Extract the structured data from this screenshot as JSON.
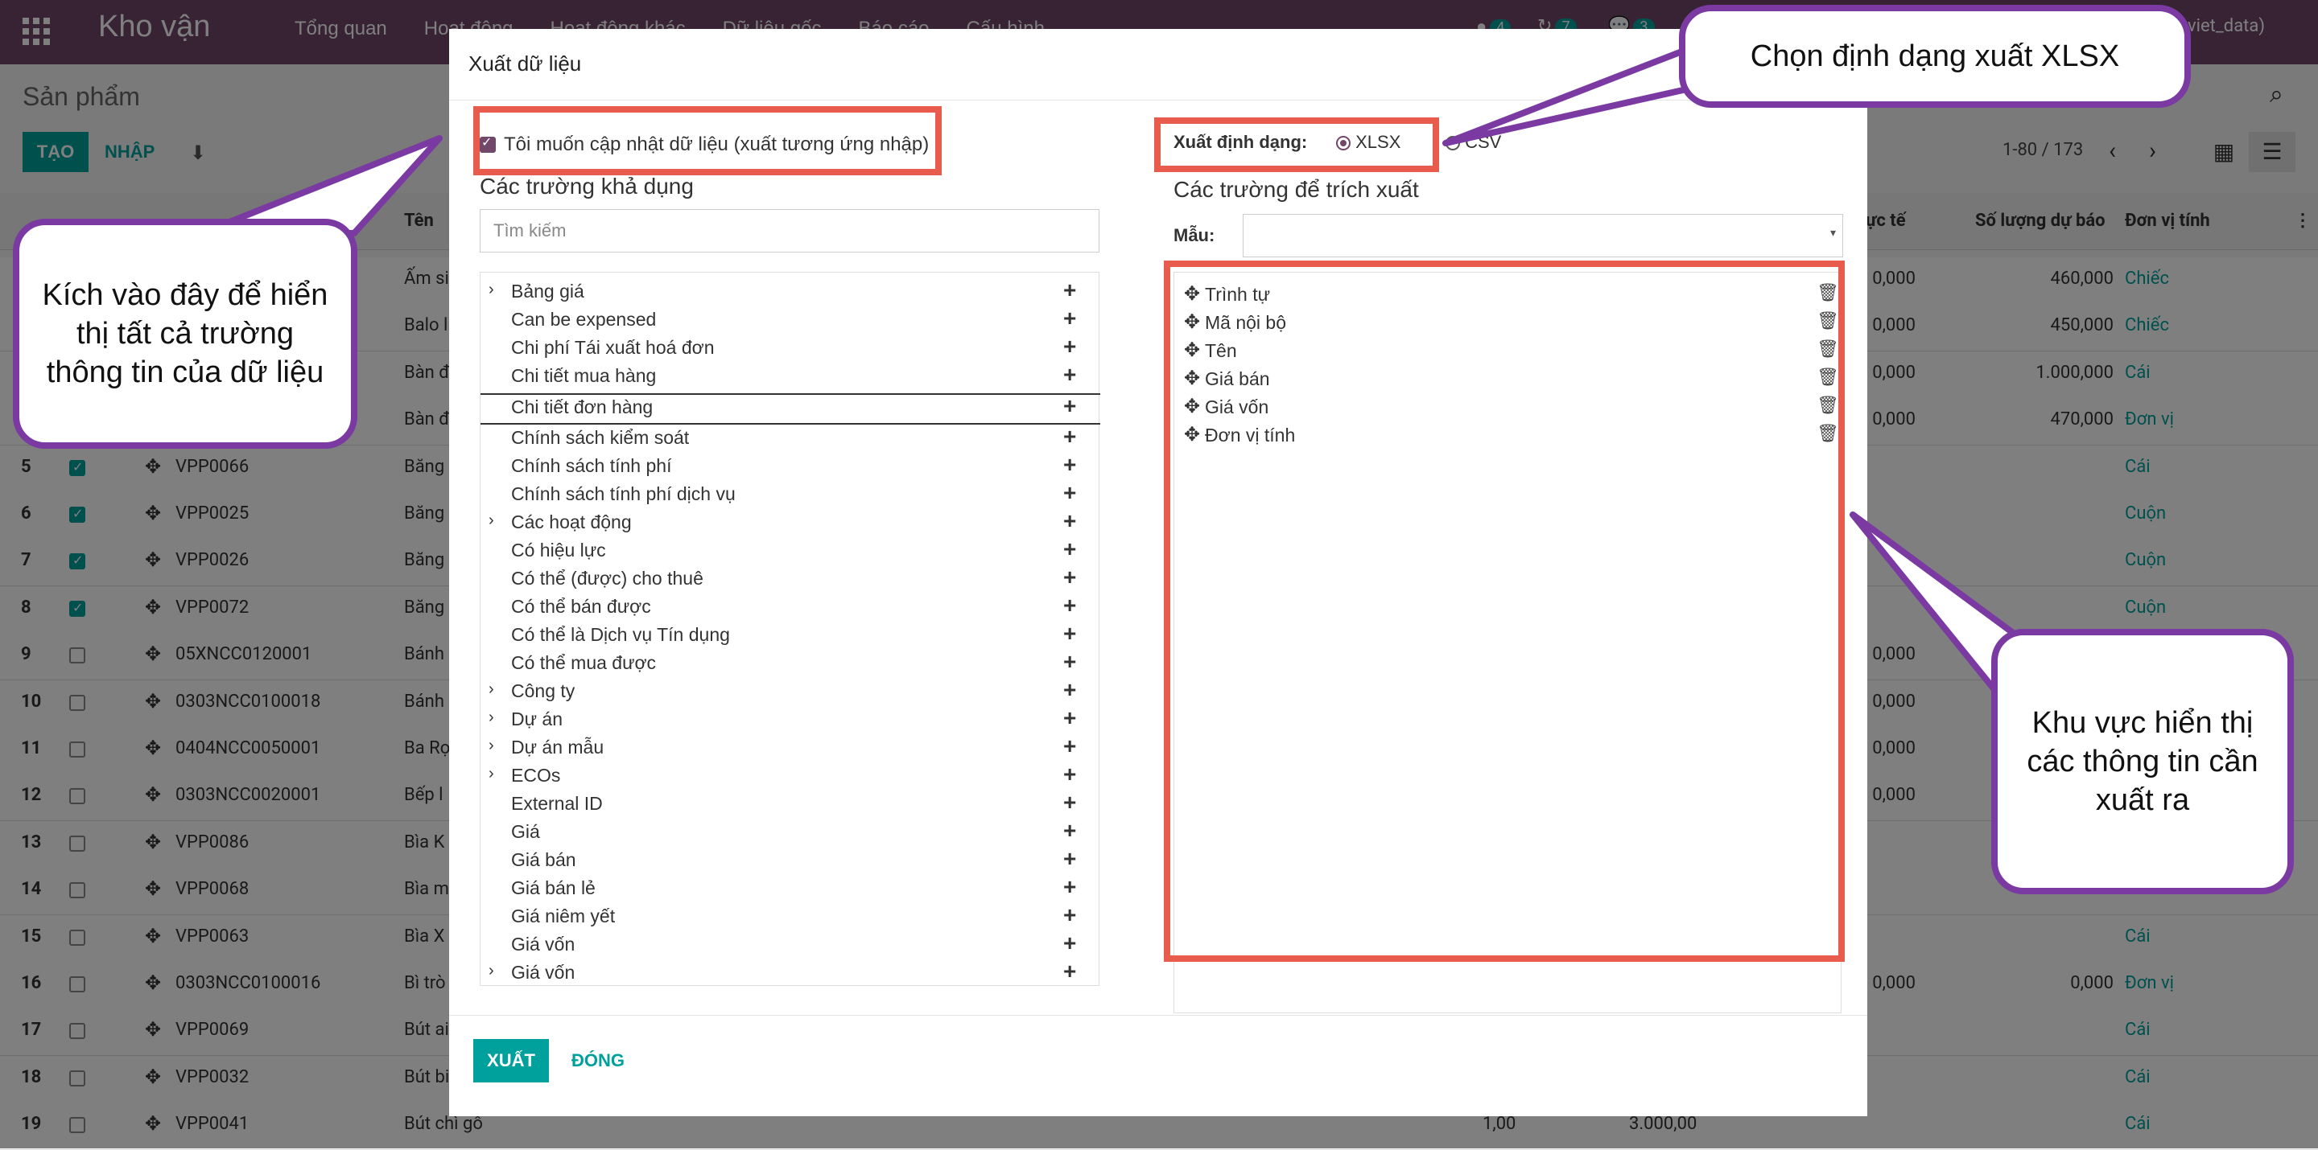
{
  "app": {
    "title": "Kho vận",
    "menu": [
      "Tổng quan",
      "Hoạt động",
      "Hoạt động khác",
      "Dữ liệu gốc",
      "Báo cáo",
      "Cấu hình"
    ],
    "badges": [
      "4",
      "7",
      "3"
    ],
    "user_suffix": "viet_data)"
  },
  "control": {
    "breadcrumb": "Sản phẩm",
    "create_label": "TẠO",
    "import_label": "NHẬP",
    "pager": "1-80 / 173"
  },
  "list": {
    "headers": {
      "name": "Tên",
      "cost": "ực tế",
      "forecast": "Số lượng dự báo",
      "unit": "Đơn vị tính"
    },
    "rows": [
      {
        "n": "",
        "code": "",
        "name": "Ấm si",
        "c1": "",
        "c2": "",
        "c3": "0,000",
        "c4": "460,000",
        "unit": "Chiếc",
        "checked": false
      },
      {
        "n": "",
        "code": "",
        "name": "Balo l",
        "c1": "",
        "c2": "",
        "c3": "0,000",
        "c4": "450,000",
        "unit": "Chiếc",
        "checked": false
      },
      {
        "n": "",
        "code": "",
        "name": "Bàn đ",
        "c1": "",
        "c2": "",
        "c3": "0,000",
        "c4": "1.000,000",
        "unit": "Cái",
        "checked": false
      },
      {
        "n": "",
        "code": "",
        "name": "Bàn đ",
        "c1": "",
        "c2": "",
        "c3": "0,000",
        "c4": "470,000",
        "unit": "Đơn vị",
        "checked": false
      },
      {
        "n": "5",
        "code": "VPP0066",
        "name": "Băng",
        "c1": "",
        "c2": "",
        "c3": "",
        "c4": "",
        "unit": "Cái",
        "checked": true
      },
      {
        "n": "6",
        "code": "VPP0025",
        "name": "Băng",
        "c1": "",
        "c2": "",
        "c3": "",
        "c4": "",
        "unit": "Cuộn",
        "checked": true
      },
      {
        "n": "7",
        "code": "VPP0026",
        "name": "Băng",
        "c1": "",
        "c2": "",
        "c3": "",
        "c4": "",
        "unit": "Cuộn",
        "checked": true
      },
      {
        "n": "8",
        "code": "VPP0072",
        "name": "Băng",
        "c1": "",
        "c2": "",
        "c3": "",
        "c4": "",
        "unit": "Cuộn",
        "checked": true
      },
      {
        "n": "9",
        "code": "05XNCC0120001",
        "name": "Bánh",
        "c1": "",
        "c2": "",
        "c3": "0,000",
        "c4": "",
        "unit": "",
        "checked": false
      },
      {
        "n": "10",
        "code": "0303NCC0100018",
        "name": "Bánh",
        "c1": "",
        "c2": "",
        "c3": "0,000",
        "c4": "",
        "unit": "",
        "checked": false
      },
      {
        "n": "11",
        "code": "0404NCC0050001",
        "name": "Ba Rọ",
        "c1": "",
        "c2": "",
        "c3": "0,000",
        "c4": "",
        "unit": "",
        "checked": false
      },
      {
        "n": "12",
        "code": "0303NCC0020001",
        "name": "Bếp l",
        "c1": "",
        "c2": "",
        "c3": "0,000",
        "c4": "",
        "unit": "",
        "checked": false
      },
      {
        "n": "13",
        "code": "VPP0086",
        "name": "Bìa K",
        "c1": "",
        "c2": "",
        "c3": "",
        "c4": "",
        "unit": "",
        "checked": false
      },
      {
        "n": "14",
        "code": "VPP0068",
        "name": "Bìa m",
        "c1": "",
        "c2": "",
        "c3": "",
        "c4": "",
        "unit": "",
        "checked": false
      },
      {
        "n": "15",
        "code": "VPP0063",
        "name": "Bìa X",
        "c1": "",
        "c2": "",
        "c3": "",
        "c4": "",
        "unit": "Cái",
        "checked": false
      },
      {
        "n": "16",
        "code": "0303NCC0100016",
        "name": "Bì trò",
        "c1": "",
        "c2": "",
        "c3": "0,000",
        "c4": "0,000",
        "unit": "Đơn vị",
        "checked": false
      },
      {
        "n": "17",
        "code": "VPP0069",
        "name": "Bút ai",
        "c1": "",
        "c2": "",
        "c3": "",
        "c4": "",
        "unit": "Cái",
        "checked": false
      },
      {
        "n": "18",
        "code": "VPP0032",
        "name": "Bút bi",
        "c1": "",
        "c2": "",
        "c3": "",
        "c4": "",
        "unit": "Cái",
        "checked": false
      },
      {
        "n": "19",
        "code": "VPP0041",
        "name": "Bút chì gỗ",
        "c1": "1,00",
        "c2": "3.000,00",
        "c3": "",
        "c4": "",
        "unit": "Cái",
        "checked": false
      }
    ]
  },
  "dialog": {
    "title": "Xuất dữ liệu",
    "update_checkbox": "Tôi muốn cập nhật dữ liệu (xuất tương ứng nhập)",
    "available_title": "Các trường khả dụng",
    "search_placeholder": "Tìm kiếm",
    "format_label": "Xuất định dạng:",
    "format_xlsx": "XLSX",
    "format_csv": "CSV",
    "export_title": "Các trường để trích xuất",
    "template_label": "Mẫu:",
    "available_fields": [
      {
        "label": "Bảng giá",
        "expand": true
      },
      {
        "label": "Can be expensed",
        "expand": false
      },
      {
        "label": "Chi phí Tái xuất hoá đơn",
        "expand": false
      },
      {
        "label": "Chi tiết mua hàng",
        "expand": false
      },
      {
        "label": "Chi tiết đơn hàng",
        "expand": false
      },
      {
        "label": "Chính sách kiểm soát",
        "expand": false
      },
      {
        "label": "Chính sách tính phí",
        "expand": false
      },
      {
        "label": "Chính sách tính phí dịch vụ",
        "expand": false
      },
      {
        "label": "Các hoạt động",
        "expand": true
      },
      {
        "label": "Có hiệu lực",
        "expand": false
      },
      {
        "label": "Có thể (được) cho thuê",
        "expand": false
      },
      {
        "label": "Có thể bán được",
        "expand": false
      },
      {
        "label": "Có thể là Dịch vụ Tín dụng",
        "expand": false
      },
      {
        "label": "Có thể mua được",
        "expand": false
      },
      {
        "label": "Công ty",
        "expand": true
      },
      {
        "label": "Dự án",
        "expand": true
      },
      {
        "label": "Dự án mẫu",
        "expand": true
      },
      {
        "label": "ECOs",
        "expand": true
      },
      {
        "label": "External ID",
        "expand": false
      },
      {
        "label": "Giá",
        "expand": false
      },
      {
        "label": "Giá bán",
        "expand": false
      },
      {
        "label": "Giá bán lẻ",
        "expand": false
      },
      {
        "label": "Giá niêm yết",
        "expand": false
      },
      {
        "label": "Giá vốn",
        "expand": false
      },
      {
        "label": "Giá vốn",
        "expand": true
      }
    ],
    "export_fields": [
      "Trình tự",
      "Mã nội bộ",
      "Tên",
      "Giá bán",
      "Giá vốn",
      "Đơn vị tính"
    ],
    "export_button": "XUẤT",
    "close_button": "ĐÓNG"
  },
  "callouts": {
    "left": "Kích vào đây để hiển thị tất cả trường thông tin của dữ liệu",
    "top": "Chọn định dạng xuất XLSX",
    "right": "Khu vực hiển thị các thông tin cần xuất ra"
  },
  "colors": {
    "brand": "#71476a",
    "accent": "#00a09d",
    "highlight": "#e95b4d",
    "callout_border": "#7a3aa2"
  }
}
